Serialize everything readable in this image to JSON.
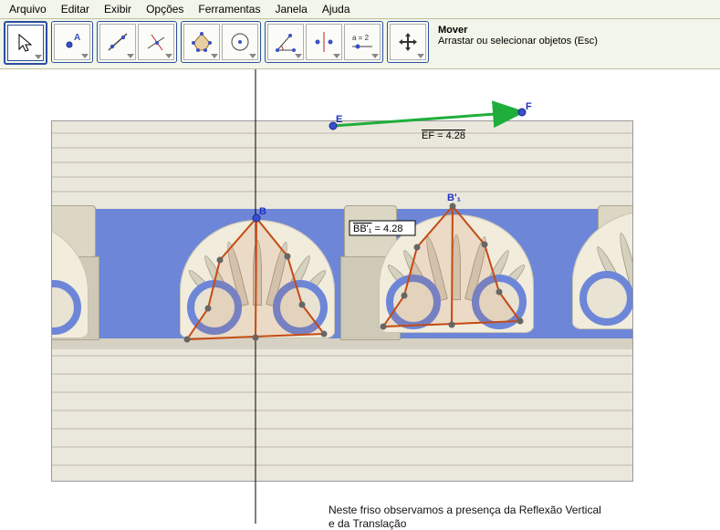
{
  "menu": {
    "arquivo": "Arquivo",
    "editar": "Editar",
    "exibir": "Exibir",
    "opcoes": "Opções",
    "ferramentas": "Ferramentas",
    "janela": "Janela",
    "ajuda": "Ajuda"
  },
  "toolbar": {
    "help_title": "Mover",
    "help_text": "Arrastar ou selecionar objetos (Esc)",
    "slider_label": "a = 2",
    "point_A_label": "A"
  },
  "labels": {
    "E": "E",
    "F": "F",
    "B": "B",
    "B1": "B'₁",
    "EF_text": "EF = 4.28",
    "BB1_seg": "BB'₁",
    "BB1_eq": " = 4.28"
  },
  "caption": {
    "line1": "Neste friso observamos a presença da Reflexão Vertical",
    "line2": "e da Translação"
  }
}
